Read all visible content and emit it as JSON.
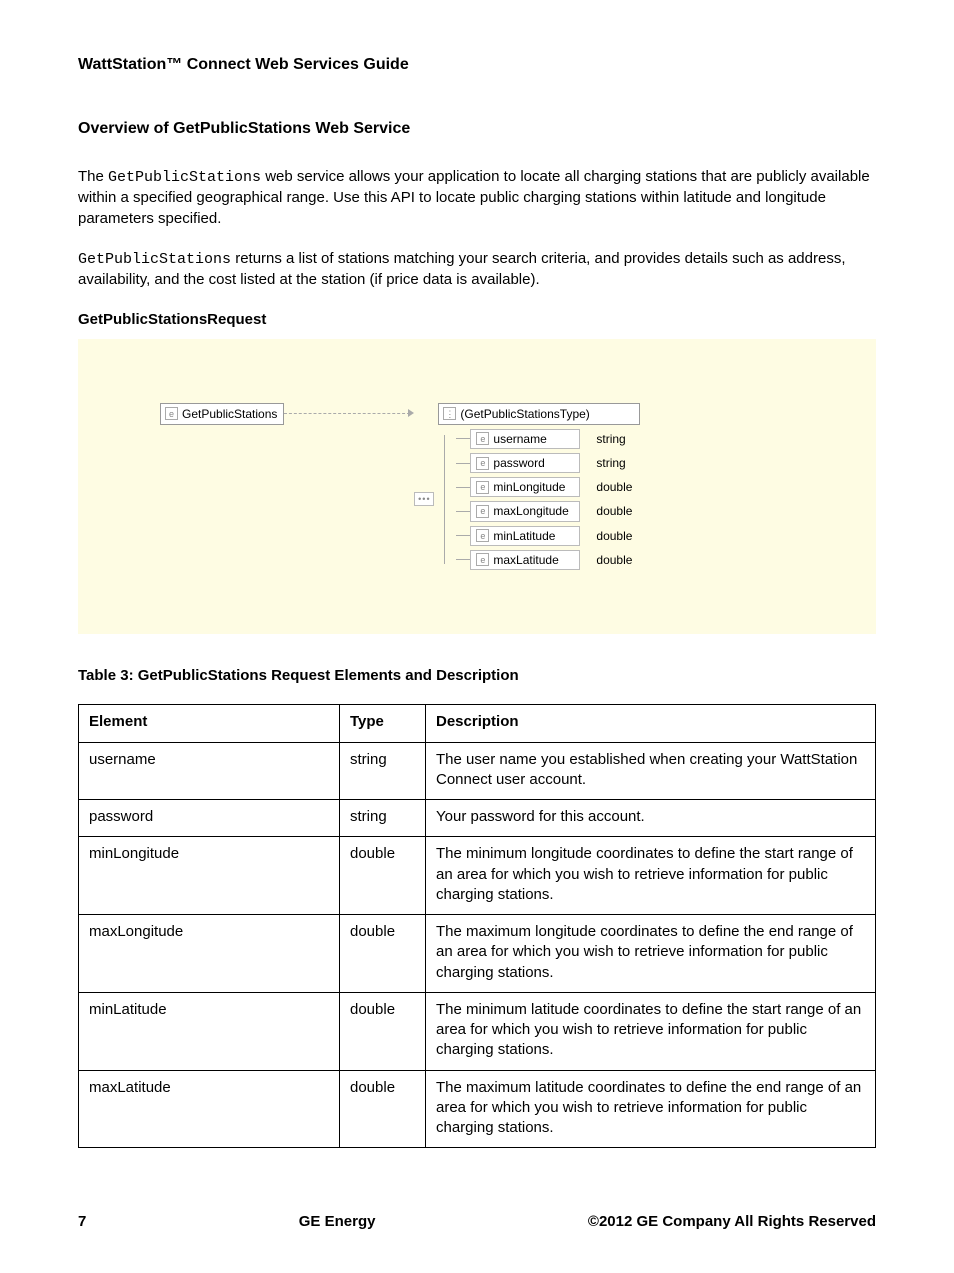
{
  "doc_title": "WattStation™ Connect Web Services Guide",
  "section_title": "Overview of GetPublicStations Web Service",
  "para1_pre": "The ",
  "para1_code": "GetPublicStations",
  "para1_post": " web service allows your application to locate all charging stations that are publicly available within a specified geographical range. Use this API to locate public charging stations within latitude and longitude parameters specified.",
  "para2_code": "GetPublicStations",
  "para2_post": " returns a list of stations matching your search criteria, and provides details such as address, availability, and the cost listed at the station (if price data is available).",
  "request_heading": "GetPublicStationsRequest",
  "diagram": {
    "root": "GetPublicStations",
    "type_label": "(GetPublicStationsType)",
    "fields": [
      {
        "name": "username",
        "type": "string"
      },
      {
        "name": "password",
        "type": "string"
      },
      {
        "name": "minLongitude",
        "type": "double"
      },
      {
        "name": "maxLongitude",
        "type": "double"
      },
      {
        "name": "minLatitude",
        "type": "double"
      },
      {
        "name": "maxLatitude",
        "type": "double"
      }
    ]
  },
  "table_caption": "Table 3: GetPublicStations Request Elements and Description",
  "table": {
    "headers": [
      "Element",
      "Type",
      "Description"
    ],
    "rows": [
      {
        "element": "username",
        "type": "string",
        "desc": "The user name you established when creating your WattStation Connect user account."
      },
      {
        "element": "password",
        "type": "string",
        "desc": "Your password for this account."
      },
      {
        "element": "minLongitude",
        "type": "double",
        "desc": "The minimum longitude coordinates to define the start range of an area for which you wish to retrieve information for public charging stations."
      },
      {
        "element": "maxLongitude",
        "type": "double",
        "desc": "The maximum longitude coordinates to define the end range of an area for which you wish to retrieve information for public charging stations."
      },
      {
        "element": "minLatitude",
        "type": "double",
        "desc": "The minimum latitude coordinates to define the start range of an area for which you wish to retrieve information for public charging stations."
      },
      {
        "element": "maxLatitude",
        "type": "double",
        "desc": "The maximum latitude coordinates to define the end range of an area for which you wish to retrieve information for public charging stations."
      }
    ]
  },
  "footer": {
    "page": "7",
    "center": "GE Energy",
    "right": "©2012 GE Company All Rights Reserved"
  }
}
